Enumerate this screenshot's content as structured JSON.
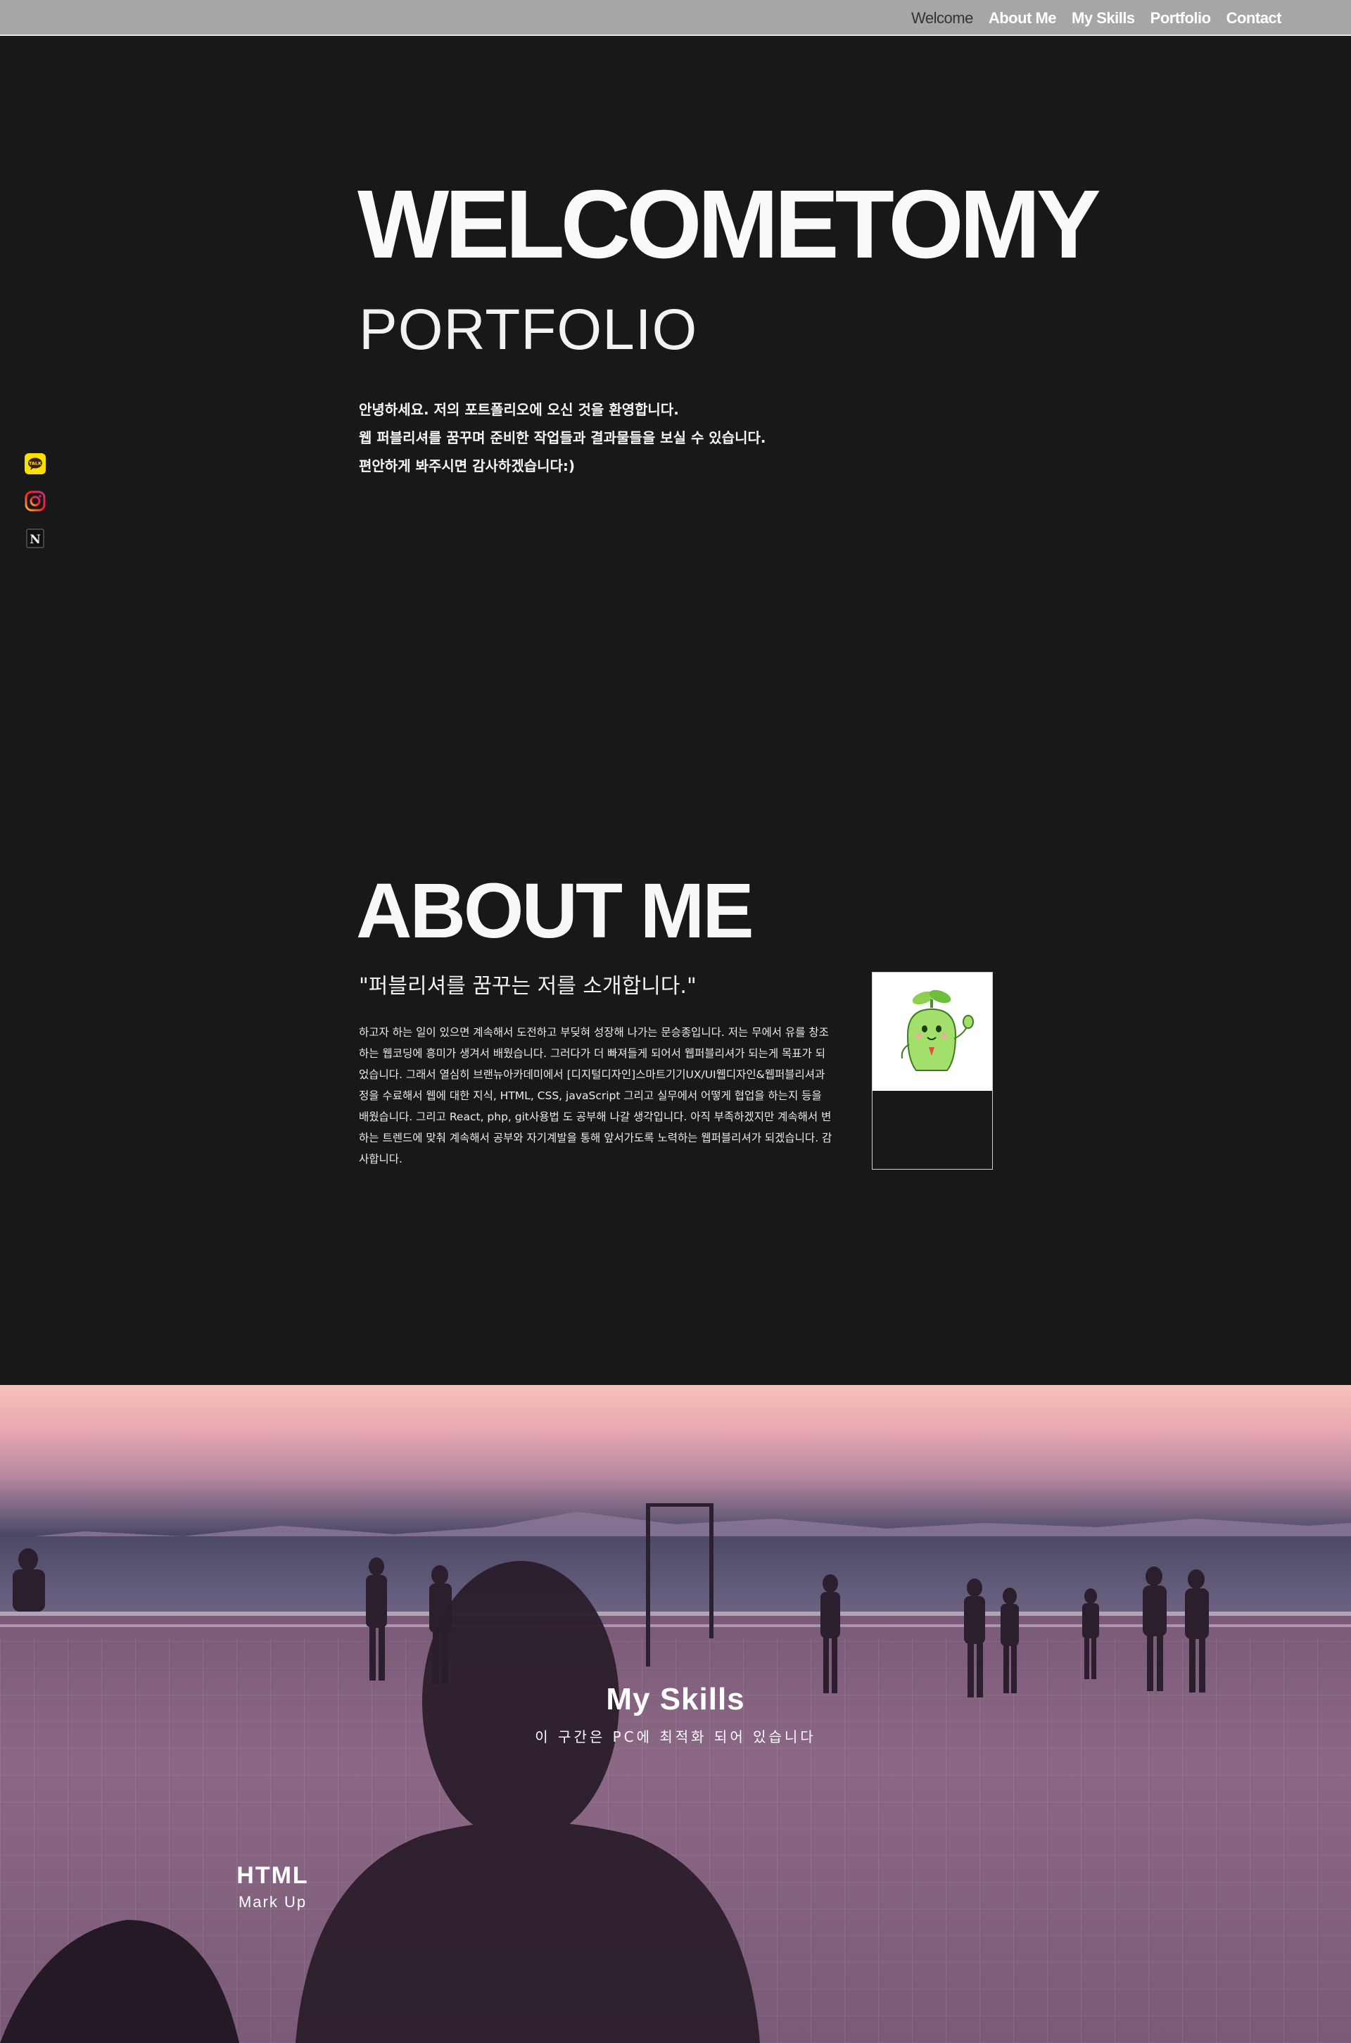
{
  "nav": {
    "items": [
      {
        "label": "Welcome",
        "active": true
      },
      {
        "label": "About Me",
        "active": false
      },
      {
        "label": "My Skills",
        "active": false
      },
      {
        "label": "Portfolio",
        "active": false
      },
      {
        "label": "Contact",
        "active": false
      }
    ]
  },
  "social": {
    "icons": [
      "kakaotalk-icon",
      "instagram-icon",
      "notion-icon"
    ],
    "colors": {
      "kakao": "#f9e000",
      "instagram": "#e1306c",
      "notion": "#111111"
    }
  },
  "welcome": {
    "title": "WELCOMETOMY",
    "subtitle": "PORTFOLIO",
    "lines": [
      "안녕하세요. 저의 포트폴리오에 오신 것을 환영합니다.",
      "웹 퍼블리셔를 꿈꾸며 준비한 작업들과 결과물들을 보실 수 있습니다.",
      "편안하게 봐주시면 감사하겠습니다:)"
    ]
  },
  "about": {
    "title": "ABOUT ME",
    "quote": "\"퍼블리셔를 꿈꾸는 저를 소개합니다.\"",
    "body": "하고자 하는 일이 있으면 계속해서 도전하고 부딪혀 성장해 나가는 문승종입니다. 저는 무에서 유를 창조하는 웹코딩에 흥미가 생겨서 배웠습니다. 그러다가 더 빠져들게 되어서 웹퍼블리셔가 되는게 목표가 되었습니다. 그래서 열심히 브랜뉴아카데미에서 [디지털디자인]스마트기기UX/UI웹디자인&웹퍼블리셔과정을 수료해서 웹에 대한 지식, HTML, CSS, javaScript 그리고 실무에서 어떻게 협업을 하는지 등을 배웠습니다. 그리고 React, php, git사용법 도 공부해 나갈 생각입니다. 아직 부족하겠지만 계속해서 변하는 트렌드에 맞춰 계속해서 공부와 자기계발을 통해 앞서가도록 노력하는 웹퍼블리셔가 되겠습니다. 감사합니다.",
    "photo_icon": "sprout-character-icon"
  },
  "skills": {
    "title": "My Skills",
    "subtitle": "이 구간은 PC에 최적화 되어 있습니다",
    "items": [
      {
        "name": "HTML",
        "desc": "Mark Up"
      }
    ]
  }
}
